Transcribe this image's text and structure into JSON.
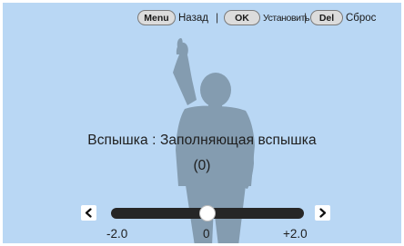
{
  "hint_bar": {
    "menu_key": "Menu",
    "menu_action": "Назад",
    "separator": "|",
    "ok_key": "OK",
    "ok_action": "Установить",
    "del_key": "Del",
    "del_action": "Сброс"
  },
  "setting": {
    "title": "Вспышка : Заполняющая вспышка",
    "value_display": "(0)"
  },
  "slider": {
    "min_label": "-2.0",
    "mid_label": "0",
    "max_label": "+2.0",
    "min": -2.0,
    "max": 2.0,
    "value": 0,
    "left_arrow": "chevron-left-icon",
    "right_arrow": "chevron-right-icon"
  },
  "colors": {
    "background": "#b9d7f4",
    "silhouette": "#849cb0",
    "track": "#262626",
    "knob": "#ffffff"
  }
}
